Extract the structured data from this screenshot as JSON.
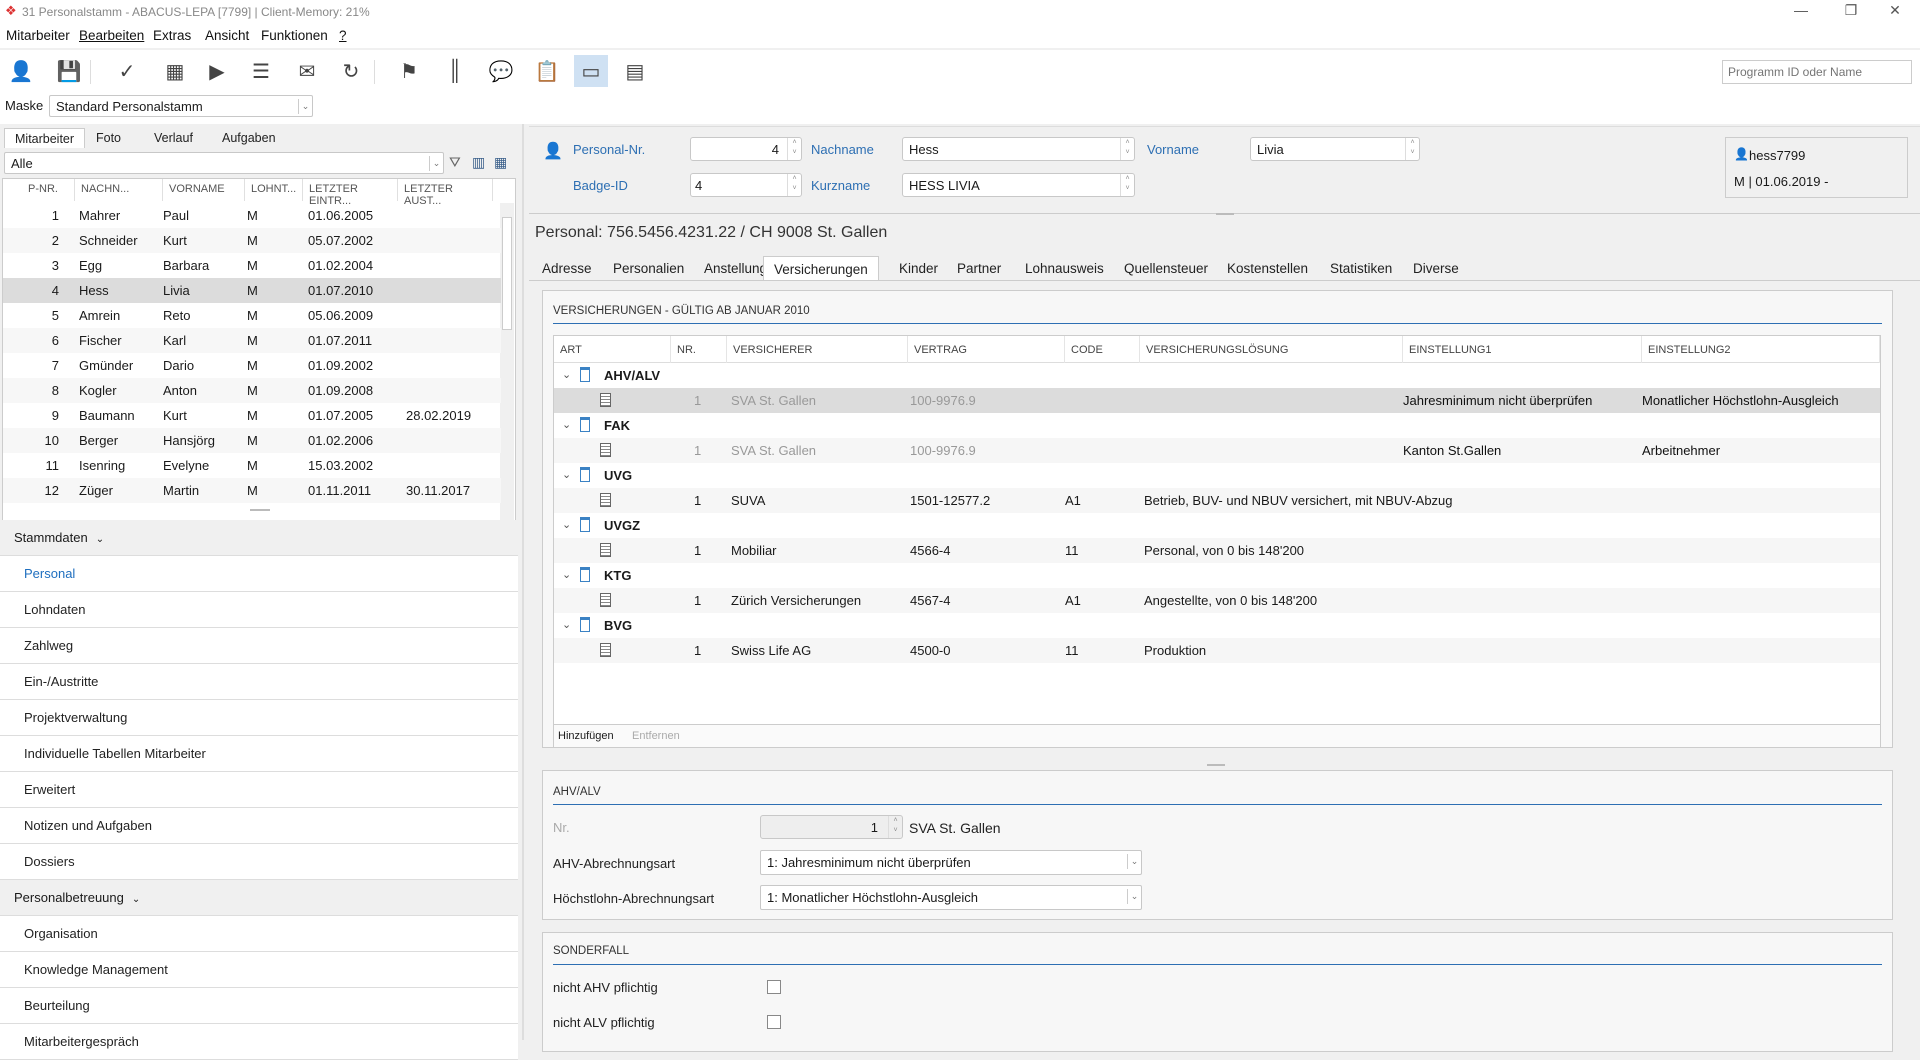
{
  "window": {
    "title": "31 Personalstamm - ABACUS-LEPA [7799] | Client-Memory: 21%"
  },
  "menu": [
    "Mitarbeiter",
    "Bearbeiten",
    "Extras",
    "Ansicht",
    "Funktionen",
    "?"
  ],
  "toolbar": {
    "icons": [
      "add-user-icon",
      "save-icon",
      "check-icon",
      "calculator-icon",
      "play-icon",
      "report-icon",
      "mail-add-icon",
      "refresh-icon",
      "mailbox-icon",
      "barcode-icon",
      "chat-add-icon",
      "clipboard-add-icon",
      "window-icon",
      "layout-icon"
    ],
    "active": "window-icon"
  },
  "search": {
    "placeholder": "Programm ID oder Name"
  },
  "mask": {
    "label": "Maske",
    "value": "Standard Personalstamm"
  },
  "left": {
    "tabs": [
      "Mitarbeiter",
      "Foto",
      "Verlauf",
      "Aufgaben"
    ],
    "active_tab": "Mitarbeiter",
    "filter": "Alle",
    "columns": [
      "P-NR.",
      "NACHN...",
      "VORNAME",
      "LOHNT...",
      "LETZTER EINTR...",
      "LETZTER AUST..."
    ],
    "rows": [
      [
        "1",
        "Mahrer",
        "Paul",
        "M",
        "01.06.2005",
        ""
      ],
      [
        "2",
        "Schneider",
        "Kurt",
        "M",
        "05.07.2002",
        ""
      ],
      [
        "3",
        "Egg",
        "Barbara",
        "M",
        "01.02.2004",
        ""
      ],
      [
        "4",
        "Hess",
        "Livia",
        "M",
        "01.07.2010",
        ""
      ],
      [
        "5",
        "Amrein",
        "Reto",
        "M",
        "05.06.2009",
        ""
      ],
      [
        "6",
        "Fischer",
        "Karl",
        "M",
        "01.07.2011",
        ""
      ],
      [
        "7",
        "Gmünder",
        "Dario",
        "M",
        "01.09.2002",
        ""
      ],
      [
        "8",
        "Kogler",
        "Anton",
        "M",
        "01.09.2008",
        ""
      ],
      [
        "9",
        "Baumann",
        "Kurt",
        "M",
        "01.07.2005",
        "28.02.2019"
      ],
      [
        "10",
        "Berger",
        "Hansjörg",
        "M",
        "01.02.2006",
        ""
      ],
      [
        "11",
        "Isenring",
        "Evelyne",
        "M",
        "15.03.2002",
        ""
      ],
      [
        "12",
        "Züger",
        "Martin",
        "M",
        "01.11.2011",
        "30.11.2017"
      ]
    ],
    "selected_row": 3
  },
  "nav": {
    "groups": [
      {
        "label": "Stammdaten",
        "items": [
          "Personal",
          "Lohndaten",
          "Zahlweg",
          "Ein-/Austritte",
          "Projektverwaltung",
          "Individuelle Tabellen Mitarbeiter",
          "Erweitert",
          "Notizen und Aufgaben",
          "Dossiers"
        ]
      },
      {
        "label": "Personalbetreuung",
        "items": [
          "Organisation",
          "Knowledge Management",
          "Beurteilung",
          "Mitarbeitergespräch"
        ]
      }
    ],
    "active": "Personal"
  },
  "header": {
    "personal_nr_label": "Personal-Nr.",
    "personal_nr": "4",
    "nachname_label": "Nachname",
    "nachname": "Hess",
    "vorname_label": "Vorname",
    "vorname": "Livia",
    "badge_label": "Badge-ID",
    "badge": "4",
    "kurzname_label": "Kurzname",
    "kurzname": "HESS LIVIA",
    "user": "hess7799",
    "status": "M | 01.06.2019 -"
  },
  "subtitle": "Personal: 756.5456.4231.22 / CH 9008 St. Gallen",
  "tabs": [
    "Adresse",
    "Personalien",
    "Anstellung",
    "Versicherungen",
    "Kinder",
    "Partner",
    "Lohnausweis",
    "Quellensteuer",
    "Kostenstellen",
    "Statistiken",
    "Diverse"
  ],
  "active_tab": "Versicherungen",
  "insurance": {
    "title": "VERSICHERUNGEN - GÜLTIG AB JANUAR 2010",
    "columns": [
      "ART",
      "NR.",
      "VERSICHERER",
      "VERTRAG",
      "CODE",
      "VERSICHERUNGSLÖSUNG",
      "EINSTELLUNG1",
      "EINSTELLUNG2"
    ],
    "groups": [
      {
        "art": "AHV/ALV",
        "rows": [
          [
            "1",
            "SVA St. Gallen",
            "100-9976.9",
            "",
            "",
            "Jahresminimum nicht überprüfen",
            "Monatlicher Höchstlohn-Ausgleich"
          ]
        ],
        "dim": true,
        "selected": true
      },
      {
        "art": "FAK",
        "rows": [
          [
            "1",
            "SVA St. Gallen",
            "100-9976.9",
            "",
            "",
            "Kanton St.Gallen",
            "Arbeitnehmer"
          ]
        ],
        "dim": true
      },
      {
        "art": "UVG",
        "rows": [
          [
            "1",
            "SUVA",
            "1501-12577.2",
            "A1",
            "Betrieb, BUV- und NBUV versichert, mit NBUV-Abzug",
            "",
            ""
          ]
        ]
      },
      {
        "art": "UVGZ",
        "rows": [
          [
            "1",
            "Mobiliar",
            "4566-4",
            "11",
            "Personal, von 0 bis 148'200",
            "",
            ""
          ]
        ]
      },
      {
        "art": "KTG",
        "rows": [
          [
            "1",
            "Zürich Versicherungen",
            "4567-4",
            "A1",
            "Angestellte, von 0 bis 148'200",
            "",
            ""
          ]
        ]
      },
      {
        "art": "BVG",
        "rows": [
          [
            "1",
            "Swiss Life AG",
            "4500-0",
            "11",
            "Produktion",
            "",
            ""
          ]
        ]
      }
    ],
    "add_label": "Hinzufügen",
    "remove_label": "Entfernen"
  },
  "ahv": {
    "title": "AHV/ALV",
    "nr_label": "Nr.",
    "nr": "1",
    "nr_name": "SVA St. Gallen",
    "abrechnungsart_label": "AHV-Abrechnungsart",
    "abrechnungsart": "1: Jahresminimum nicht überprüfen",
    "hoechstlohn_label": "Höchstlohn-Abrechnungsart",
    "hoechstlohn": "1: Monatlicher Höchstlohn-Ausgleich"
  },
  "sonderfall": {
    "title": "SONDERFALL",
    "items": [
      {
        "label": "nicht AHV pflichtig",
        "checked": false
      },
      {
        "label": "nicht ALV pflichtig",
        "checked": false
      }
    ]
  }
}
